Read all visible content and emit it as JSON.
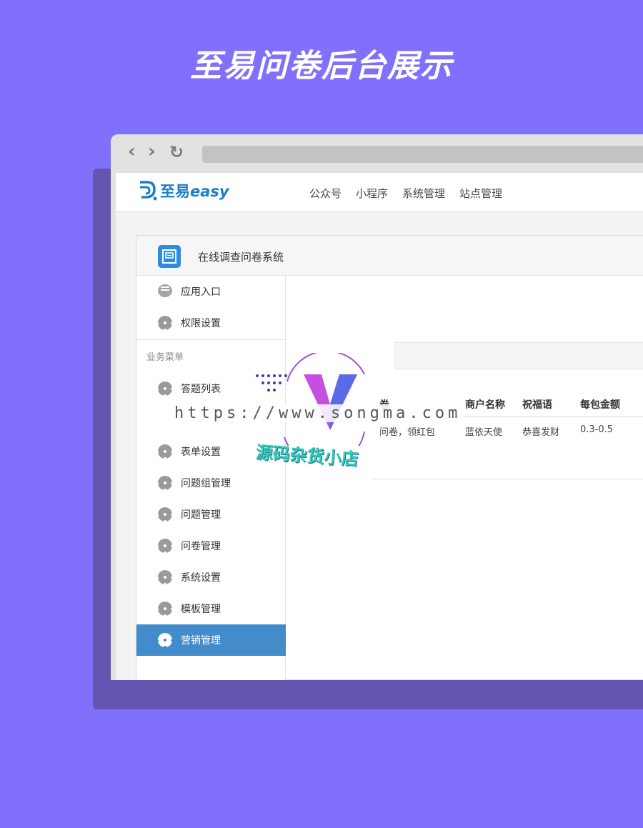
{
  "headline": "至易问卷后台展示",
  "brand": {
    "name": "至易",
    "suffix": "easy",
    "accent_color": "#1a7fc7"
  },
  "topnav": {
    "items": [
      "公众号",
      "小程序",
      "系统管理",
      "站点管理"
    ]
  },
  "panel": {
    "title": "在线调查问卷系统",
    "icon": "questionnaire-icon"
  },
  "sidebar": {
    "top_items": [
      {
        "label": "应用入口",
        "icon": "chat-bubble-icon"
      },
      {
        "label": "权限设置",
        "icon": "gear-icon"
      }
    ],
    "section_label": "业务菜单",
    "items": [
      {
        "label": "答题列表",
        "icon": "gear-icon"
      },
      {
        "label": "表单设置",
        "icon": "gear-icon"
      },
      {
        "label": "问题组管理",
        "icon": "gear-icon"
      },
      {
        "label": "问题管理",
        "icon": "gear-icon"
      },
      {
        "label": "问卷管理",
        "icon": "gear-icon"
      },
      {
        "label": "系统设置",
        "icon": "gear-icon"
      },
      {
        "label": "模板管理",
        "icon": "gear-icon"
      },
      {
        "label": "营销管理",
        "icon": "gear-icon",
        "active": true
      }
    ],
    "active_color": "#428ccb"
  },
  "table": {
    "headers": [
      "卷",
      "商户名称",
      "祝福语",
      "每包金额"
    ],
    "rows": [
      [
        "问卷，领红包",
        "蓝依天使",
        "恭喜发财",
        "0.3-0.5"
      ]
    ]
  },
  "watermark": {
    "url": "https://www.songma.com",
    "shop": "源码杂货小店"
  }
}
